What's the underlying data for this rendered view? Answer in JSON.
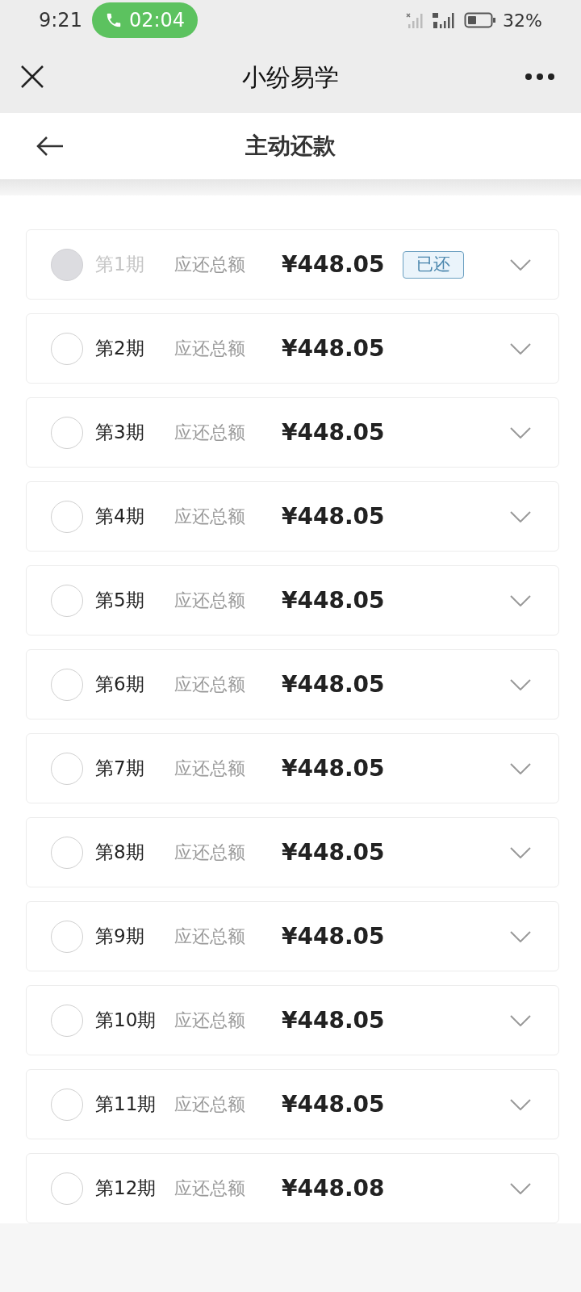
{
  "status_bar": {
    "time": "9:21",
    "call_timer": "02:04",
    "battery": "32%"
  },
  "app_bar": {
    "title": "小纷易学"
  },
  "page_header": {
    "title": "主动还款"
  },
  "installments": [
    {
      "period": "第1期",
      "label": "应还总额",
      "amount": "¥448.05",
      "paid": true,
      "badge": "已还"
    },
    {
      "period": "第2期",
      "label": "应还总额",
      "amount": "¥448.05",
      "paid": false
    },
    {
      "period": "第3期",
      "label": "应还总额",
      "amount": "¥448.05",
      "paid": false
    },
    {
      "period": "第4期",
      "label": "应还总额",
      "amount": "¥448.05",
      "paid": false
    },
    {
      "period": "第5期",
      "label": "应还总额",
      "amount": "¥448.05",
      "paid": false
    },
    {
      "period": "第6期",
      "label": "应还总额",
      "amount": "¥448.05",
      "paid": false
    },
    {
      "period": "第7期",
      "label": "应还总额",
      "amount": "¥448.05",
      "paid": false
    },
    {
      "period": "第8期",
      "label": "应还总额",
      "amount": "¥448.05",
      "paid": false
    },
    {
      "period": "第9期",
      "label": "应还总额",
      "amount": "¥448.05",
      "paid": false
    },
    {
      "period": "第10期",
      "label": "应还总额",
      "amount": "¥448.05",
      "paid": false
    },
    {
      "period": "第11期",
      "label": "应还总额",
      "amount": "¥448.05",
      "paid": false
    },
    {
      "period": "第12期",
      "label": "应还总额",
      "amount": "¥448.08",
      "paid": false
    }
  ]
}
